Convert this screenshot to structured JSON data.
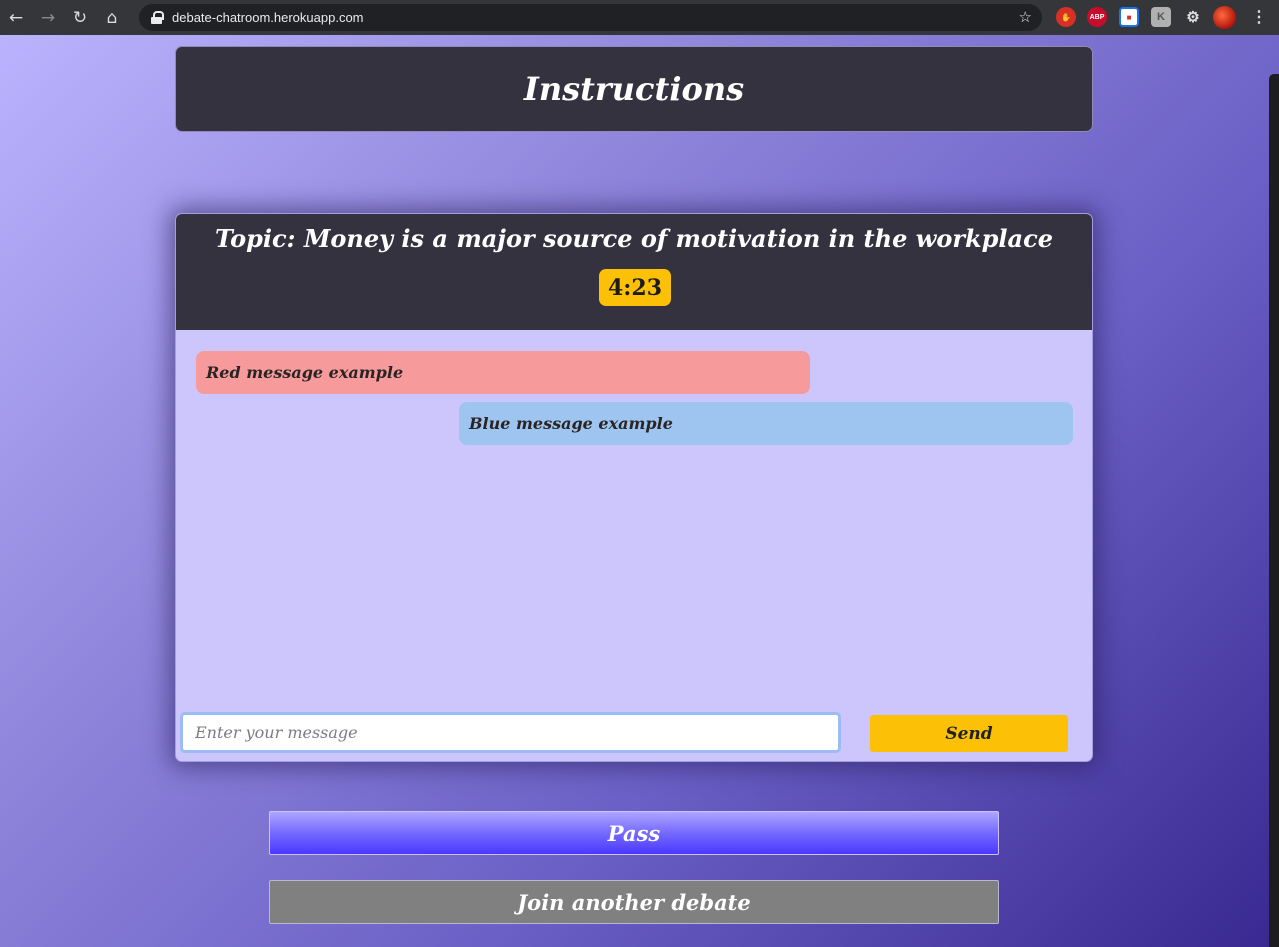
{
  "browser": {
    "url": "debate-chatroom.herokuapp.com",
    "icons": {
      "back": "back-arrow-icon",
      "forward": "forward-arrow-icon",
      "reload": "reload-icon",
      "home": "home-icon",
      "bookmark": "star-icon",
      "menu": "kebab-menu-icon"
    },
    "extensions": {
      "abp_label": "ABP",
      "k_label": "K"
    }
  },
  "page": {
    "instructions_title": "Instructions",
    "topic": "Topic: Money is a major source of motivation in the workplace",
    "timer": "4:23",
    "messages": [
      {
        "side": "red",
        "text": "Red message example"
      },
      {
        "side": "blue",
        "text": "Blue message example"
      }
    ],
    "input": {
      "placeholder": "Enter your message",
      "value": ""
    },
    "send_label": "Send",
    "pass_label": "Pass",
    "join_label": "Join another debate"
  },
  "colors": {
    "header_bg": "#34323f",
    "timer_bg": "#fcc106",
    "red_message": "#f69a9b",
    "blue_message": "#9dc5f0",
    "chat_bg": "#cdc6fd",
    "send_bg": "#fcc106",
    "join_bg": "#808080"
  }
}
